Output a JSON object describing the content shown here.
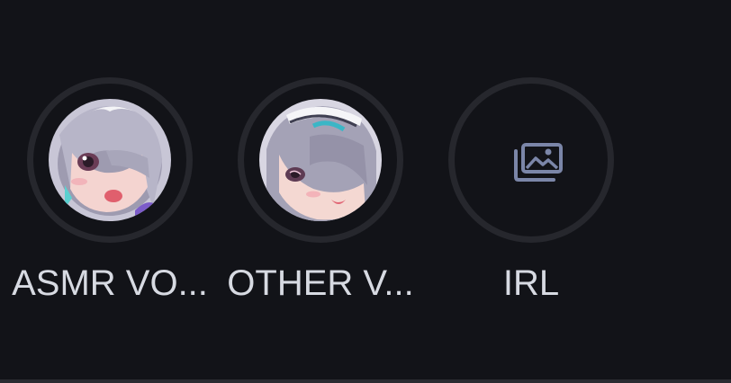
{
  "highlights": [
    {
      "label": "ASMR VO...",
      "kind": "avatar",
      "icon": "anime-avatar-1"
    },
    {
      "label": "OTHER V...",
      "kind": "avatar",
      "icon": "anime-avatar-2"
    },
    {
      "label": "IRL",
      "kind": "placeholder",
      "icon": "gallery-icon"
    }
  ],
  "colors": {
    "background": "#121318",
    "ring": "#26272d",
    "label": "#d7dae2",
    "icon": "#7b86a8"
  }
}
